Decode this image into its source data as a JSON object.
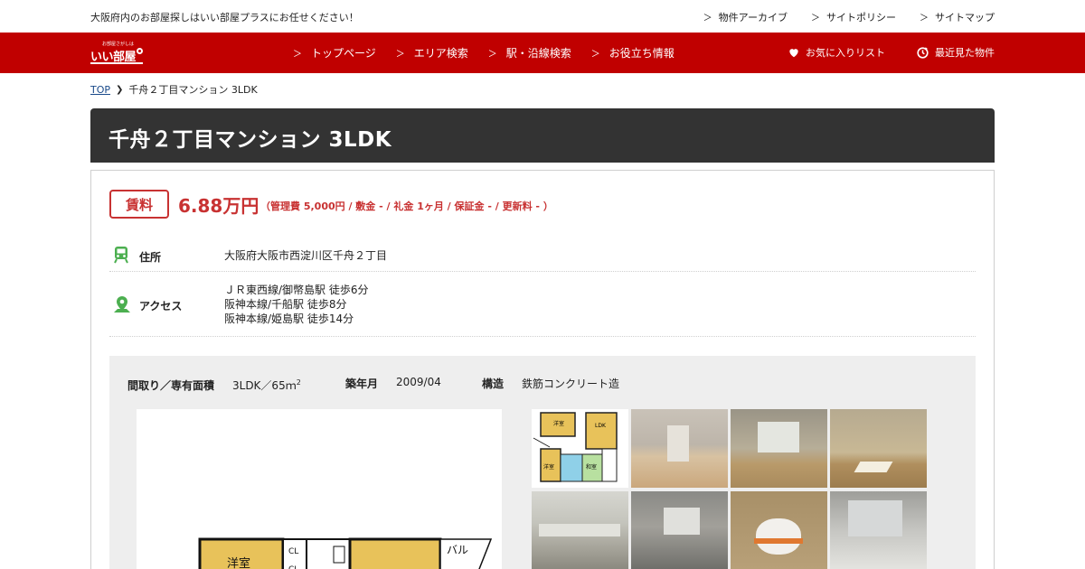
{
  "header": {
    "tagline": "大阪府内のお部屋探しはいい部屋プラスにお任せください！",
    "links": [
      {
        "label": "物件アーカイブ"
      },
      {
        "label": "サイトポリシー"
      },
      {
        "label": "サイトマップ"
      }
    ]
  },
  "nav": {
    "logo_small": "お部屋さがしは",
    "logo_main": "いい部屋",
    "menu": [
      {
        "label": "トップページ"
      },
      {
        "label": "エリア検索"
      },
      {
        "label": "駅・沿線検索"
      },
      {
        "label": "お役立ち情報"
      }
    ],
    "favorites_label": "お気に入りリスト",
    "recent_label": "最近見た物件"
  },
  "breadcrumb": {
    "top": "TOP",
    "current": "千舟２丁目マンション 3LDK"
  },
  "property": {
    "title": "千舟２丁目マンション  3LDK",
    "rent_badge": "賃料",
    "rent_price": "6.88万円",
    "rent_details": "（管理費 5,000円 / 敷金 - / 礼金 1ヶ月 / 保証金 - / 更新料 - ）",
    "address_label": "住所",
    "address": "大阪府大阪市西淀川区千舟２丁目",
    "access_label": "アクセス",
    "access": [
      "ＪＲ東西線/御幣島駅 徒歩6分",
      "阪神本線/千船駅 徒歩8分",
      "阪神本線/姫島駅 徒歩14分"
    ],
    "specs": {
      "layout_label": "間取り／専有面積",
      "layout_value": "3LDK／65ｍ",
      "layout_sup": "2",
      "built_label": "築年月",
      "built_value": "2009/04",
      "structure_label": "構造",
      "structure_value": "鉄筋コンクリート造"
    },
    "floorplan_labels": {
      "room": "洋室",
      "closet1": "CL",
      "closet2": "CL",
      "balcony": "バル"
    },
    "thumb_plan_labels": {
      "r1": "洋室",
      "ldk": "LDK",
      "r2": "洋室",
      "r3": "和室"
    }
  },
  "colors": {
    "nav_red": "#c00000",
    "title_bg": "#333333",
    "accent_red": "#c83232",
    "icon_green": "#4caf50"
  }
}
